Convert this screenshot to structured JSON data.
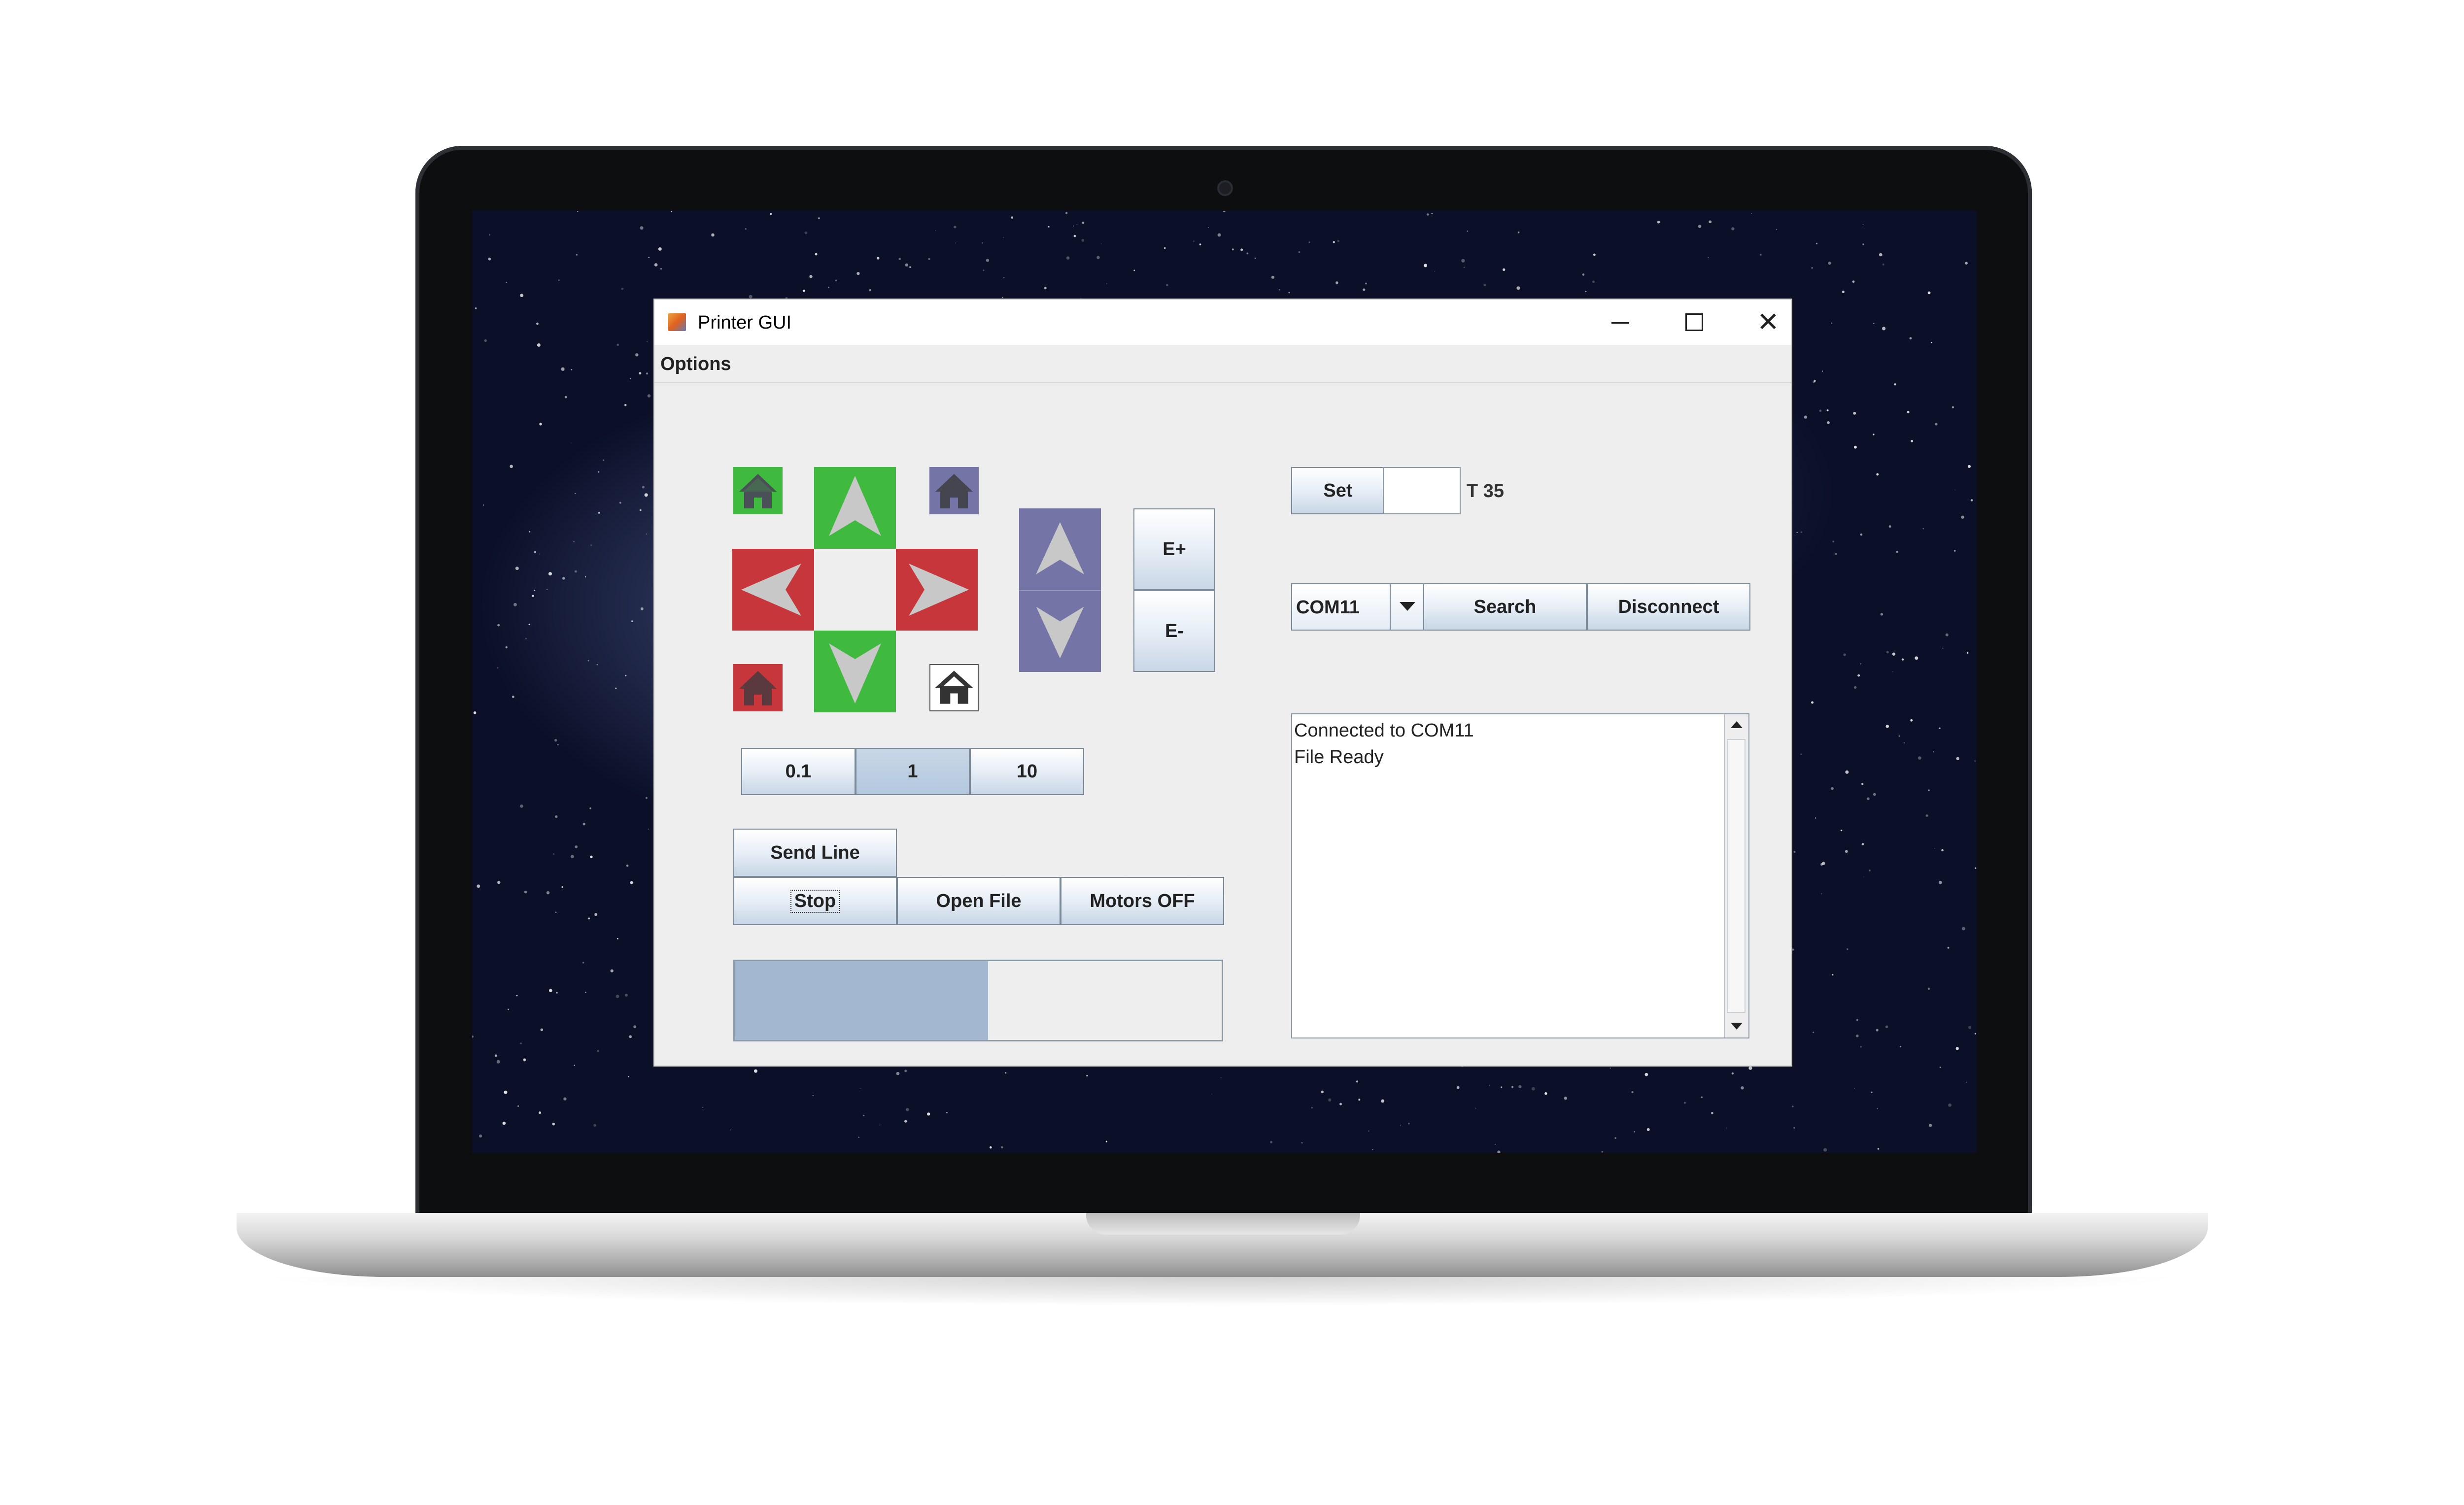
{
  "window": {
    "title": "Printer GUI",
    "controls": [
      "minimize",
      "maximize",
      "close"
    ]
  },
  "menu": {
    "options_label": "Options"
  },
  "jog": {
    "home_icons": [
      "home-green",
      "home-blue",
      "home-red",
      "home-black"
    ],
    "arrows": [
      "up",
      "left",
      "right",
      "down",
      "z-up",
      "z-down"
    ]
  },
  "extruder": {
    "plus_label": "E+",
    "minus_label": "E-"
  },
  "step": {
    "options": [
      "0.1",
      "1",
      "10"
    ],
    "selected": "1"
  },
  "buttons": {
    "send_line": "Send Line",
    "stop": "Stop",
    "open_file": "Open File",
    "motors_off": "Motors OFF"
  },
  "progress": {
    "fraction": 0.52
  },
  "temperature": {
    "set_label": "Set",
    "field_value": "",
    "status": "T 35"
  },
  "connection": {
    "port": "COM11",
    "search_label": "Search",
    "disconnect_label": "Disconnect"
  },
  "log": {
    "lines": [
      "Connected to COM11",
      "File Ready"
    ]
  },
  "colors": {
    "green": "#3fb93e",
    "red": "#c6363a",
    "blue": "#7474a6",
    "progress_fill": "#a3b8d0"
  }
}
